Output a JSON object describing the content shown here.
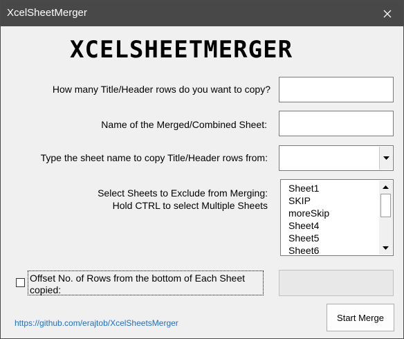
{
  "window": {
    "title": "XcelSheetMerger",
    "close_icon": "close-icon"
  },
  "logo_text": "XCELSHEETMERGER",
  "form": {
    "header_rows_label": "How many Title/Header rows do you want to copy?",
    "header_rows_value": "",
    "merged_sheet_label": "Name of the Merged/Combined Sheet:",
    "merged_sheet_value": "",
    "title_sheet_label": "Type the sheet name to copy Title/Header rows from:",
    "title_sheet_value": "",
    "exclude_label_line1": "Select Sheets to Exclude from Merging:",
    "exclude_label_line2": "Hold CTRL to select Multiple Sheets",
    "sheets": [
      "Sheet1",
      "SKIP",
      "moreSkip",
      "Sheet4",
      "Sheet5",
      "Sheet6"
    ],
    "offset_label_line1": "Offset No. of Rows from the bottom of Each Sheet",
    "offset_label_line2": "copied:",
    "offset_checked": false,
    "offset_value": ""
  },
  "footer": {
    "link_text": "https://github.com/erajtob/XcelSheetsMerger",
    "start_button": "Start Merge"
  }
}
